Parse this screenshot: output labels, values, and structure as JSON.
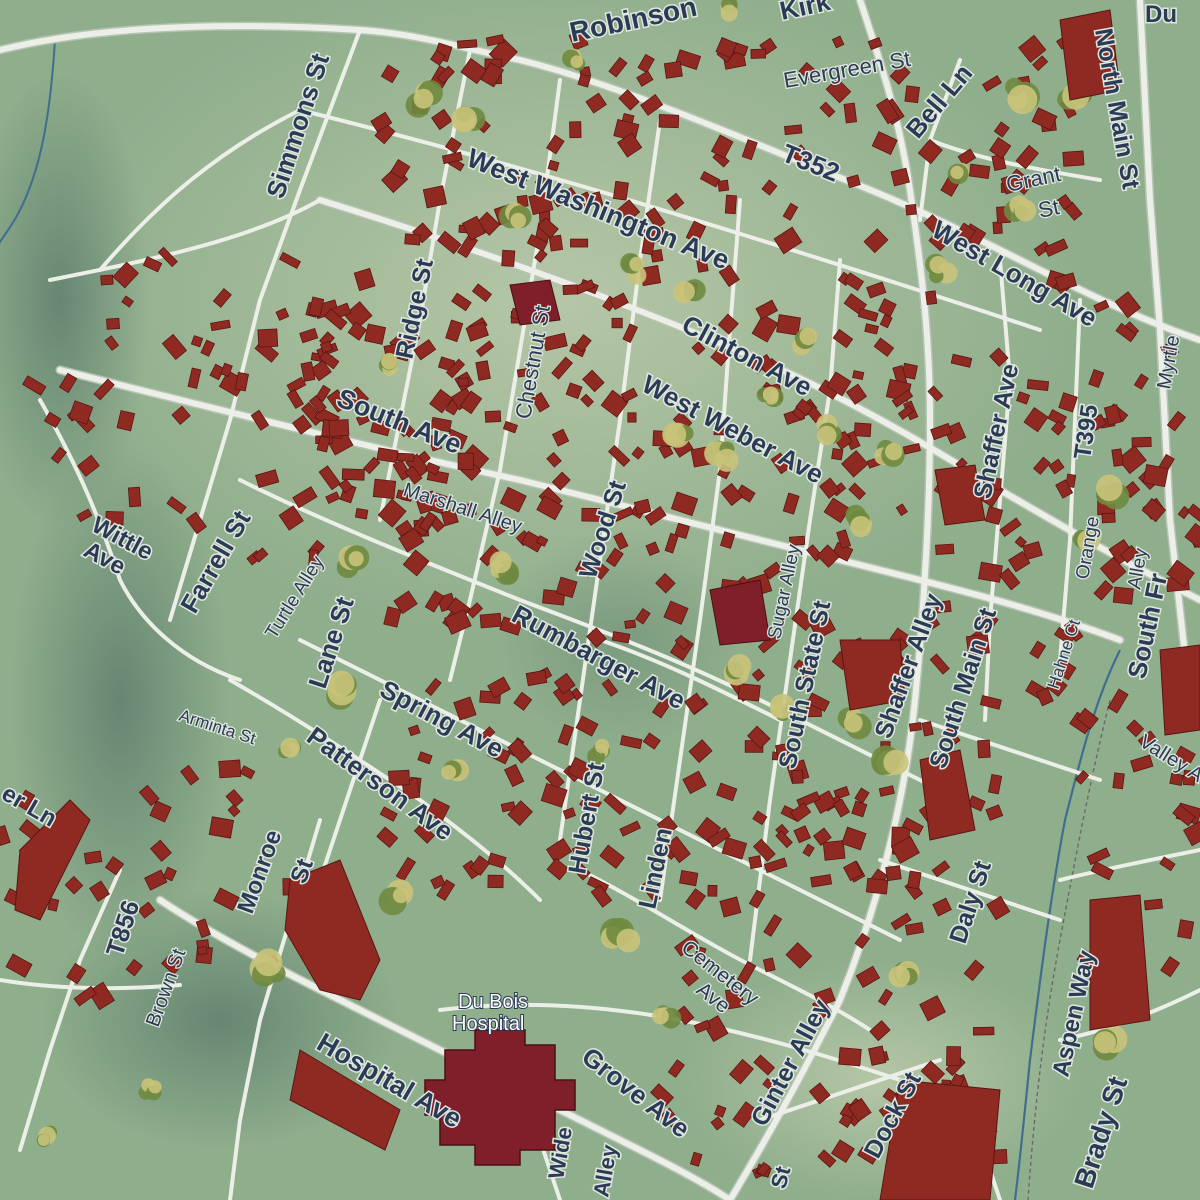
{
  "map": {
    "colors": {
      "land": "#8fae8c",
      "land_light": "#a9c0a0",
      "hill_shadow": "#6f8d78",
      "road": "#ecefe8",
      "road_edge": "#b6c2b2",
      "building": "#8f2a22",
      "building_edge": "#5a1612",
      "hospital": "#7e1f2a",
      "tree": "#c9c37a",
      "tree_dark": "#6e8a3f",
      "label": "#2b3a55",
      "label_halo": "#dfe7df",
      "stream": "#3f6e8f"
    },
    "labels": {
      "robinson": "Robinson",
      "kirk": "Kirk",
      "evergreen": "Evergreen St",
      "du": "Du",
      "simmons": "Simmons St",
      "bell": "Bell Ln",
      "north_main": "North Main St",
      "t352": "T352",
      "grant": "Grant",
      "grant_st": "St",
      "west_washington": "West Washington Ave",
      "west_long": "West Long Ave",
      "ridge": "Ridge St",
      "chestnut": "Chestnut St",
      "clinton": "Clinton Ave",
      "myrtle": "Myrtle",
      "south_ave": "South Ave",
      "west_weber": "West Weber Ave",
      "shaffer_ave": "Shaffer Ave",
      "t395": "T395",
      "wittle": "Wittle",
      "wittle_ave": "Ave",
      "farrell": "Farrell St",
      "marshall_alley": "Marshall Alley",
      "wood": "Wood St",
      "orange": "Orange",
      "orange_alley": "Alley",
      "turtle_alley": "Turtle Alley",
      "sugar_alley": "Sugar Alley",
      "south_fr": "South Fr",
      "lane": "Lane St",
      "rumbarger": "Rumbarger Ave",
      "south_state": "South State St",
      "shaffer_alley": "Shaffer Alley",
      "south_main": "South Main St",
      "hahne": "Hahne Ct",
      "arminta": "Arminta St",
      "spring": "Spring Ave",
      "valley": "Valley A",
      "patterson": "Patterson Ave",
      "hubert": "Hubert St",
      "er_ln": "er Ln",
      "linden": "Linden",
      "daly": "Daly St",
      "monroe": "Monroe",
      "monroe_st": "St",
      "t856": "T856",
      "cemetery": "Cemetery",
      "cemetery_ave": "Ave",
      "aspen": "Aspen Way",
      "brown": "Brown St",
      "ginter": "Ginter Alley",
      "hospital_name_1": "Du Bois",
      "hospital_name_2": "Hospital",
      "brady": "Brady St",
      "hospital_ave": "Hospital Ave",
      "grove": "Grove Ave",
      "dock": "Dock St",
      "wide": "Wide",
      "alley_bottom": "Alley",
      "st_bottom": "St"
    }
  }
}
